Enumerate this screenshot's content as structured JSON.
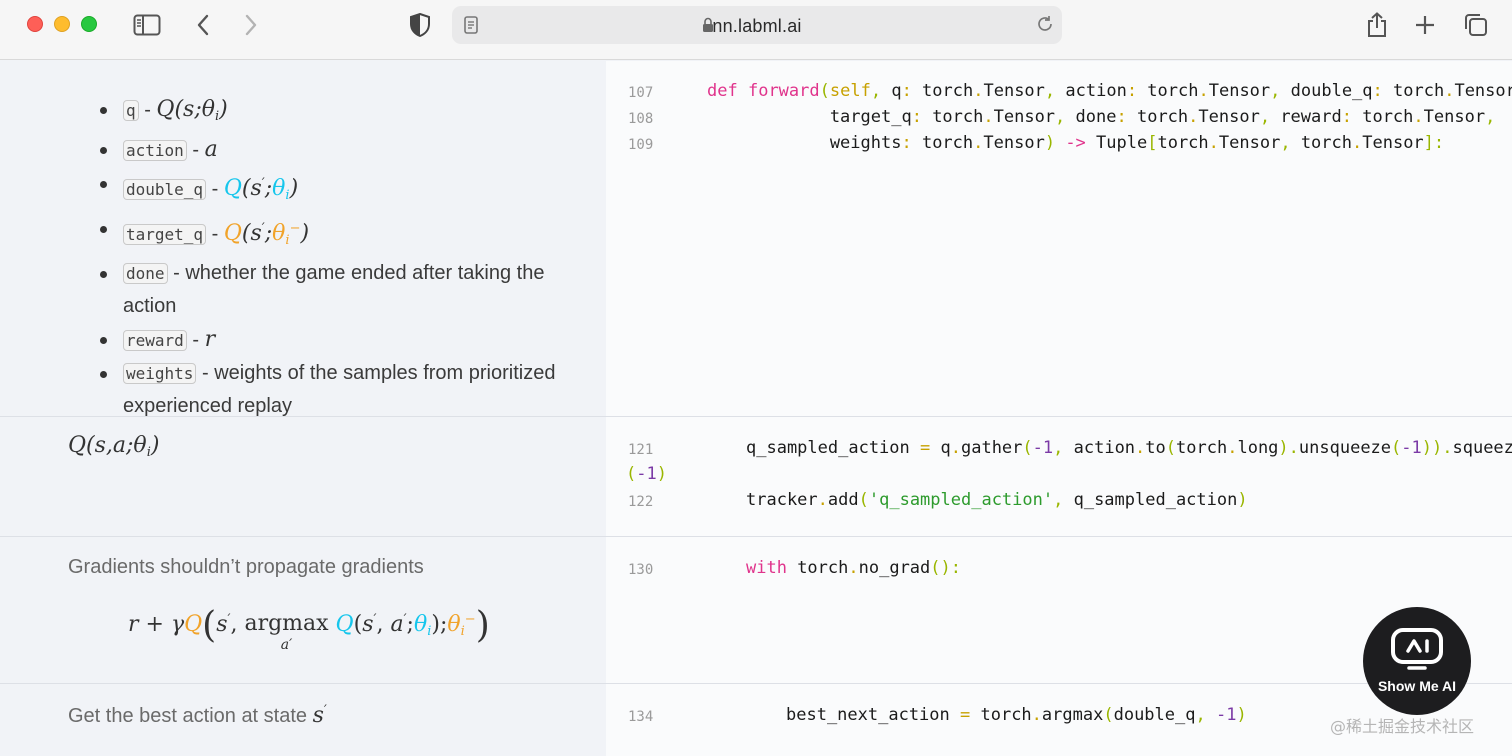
{
  "browser": {
    "url": "nn.labml.ai",
    "icons": [
      "sidebar-icon",
      "back-icon",
      "forward-icon",
      "shield-icon",
      "page-icon",
      "lock-icon",
      "reload-icon",
      "share-icon",
      "new-tab-icon",
      "tabs-icon"
    ]
  },
  "section1": {
    "params": [
      {
        "code": "q",
        "sep": " - "
      },
      {
        "code": "action",
        "sep": " - "
      },
      {
        "code": "double_q",
        "sep": " - "
      },
      {
        "code": "target_q",
        "sep": " - "
      },
      {
        "code": "done",
        "sep": " - ",
        "text": "whether the game ended after taking the action"
      },
      {
        "code": "reward",
        "sep": " - "
      },
      {
        "code": "weights",
        "sep": " - ",
        "text": "weights of the samples from prioritized experienced replay"
      }
    ],
    "line_numbers": [
      "107",
      "108",
      "109"
    ]
  },
  "section2": {
    "line_numbers": [
      "121",
      "122"
    ]
  },
  "section3": {
    "text": "Gradients shouldn’t propagate gradients",
    "line_numbers": [
      "130"
    ]
  },
  "section4": {
    "text": "Get the best action at state",
    "line_numbers": [
      "134"
    ]
  },
  "overlay": {
    "button_label": "Show Me AI",
    "watermark": "@稀土掘金技术社区"
  },
  "colors": {
    "keyword": "#e0348c",
    "cyan_math": "#16c6ec",
    "orange_math": "#f1a32a"
  }
}
